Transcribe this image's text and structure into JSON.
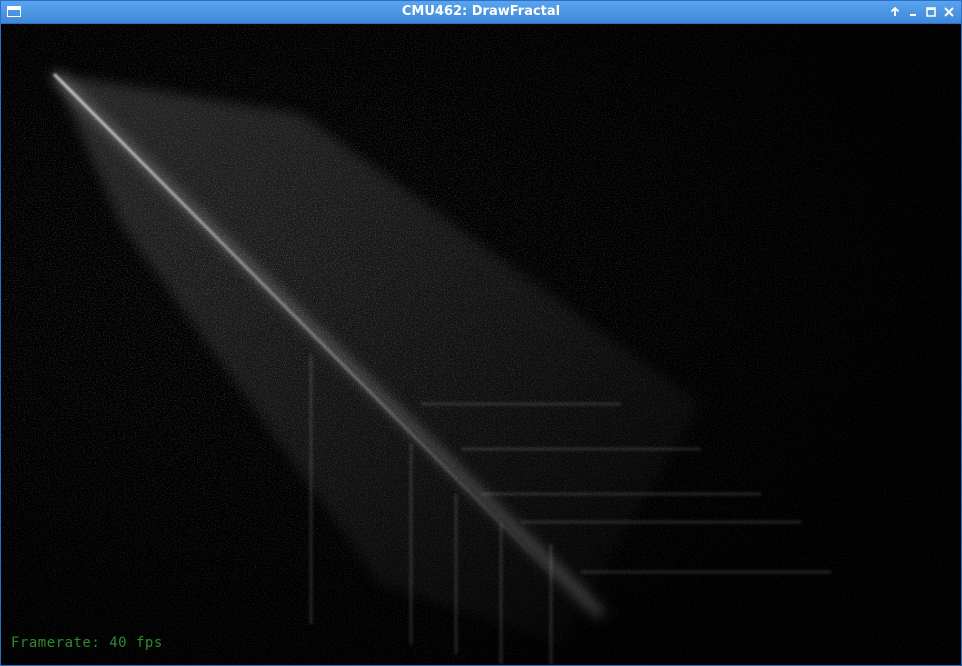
{
  "window": {
    "title": "CMU462: DrawFractal",
    "titlebar_color": "#4a94e2",
    "controls": [
      {
        "name": "keep-above-icon",
        "glyph": "↑"
      },
      {
        "name": "minimize-icon",
        "glyph": "‒"
      },
      {
        "name": "maximize-icon",
        "glyph": "□"
      },
      {
        "name": "close-icon",
        "glyph": "✕"
      }
    ]
  },
  "canvas": {
    "background": "#000000",
    "render_color": "#ffffff"
  },
  "overlay": {
    "framerate_text": "Framerate: 40 fps",
    "framerate_color": "#2e8b2e"
  }
}
